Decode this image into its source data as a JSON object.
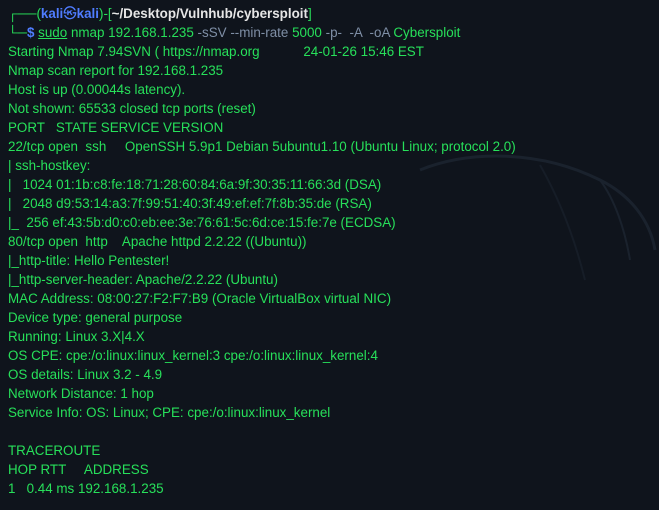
{
  "prompt": {
    "user": "kali",
    "skull": "㉿",
    "host": "kali",
    "path": "~/Desktop/Vulnhub/cybersploit",
    "sudo": "sudo",
    "program": "nmap",
    "target_ip": "192.168.1.235",
    "opt1": "-sSV",
    "opt2": "--min-rate",
    "rate": "5000",
    "opt3": "-p-",
    "opt4": "-A",
    "opt5": "-oA",
    "outname": "Cybersploit"
  },
  "output": {
    "start_a": "Starting Nmap 7.94SVN ( https://nmap.org",
    "start_b": "24-01-26 15:46 EST",
    "lines": [
      "Nmap scan report for 192.168.1.235",
      "Host is up (0.00044s latency).",
      "Not shown: 65533 closed tcp ports (reset)",
      "PORT   STATE SERVICE VERSION",
      "22/tcp open  ssh     OpenSSH 5.9p1 Debian 5ubuntu1.10 (Ubuntu Linux; protocol 2.0)",
      "| ssh-hostkey: ",
      "|   1024 01:1b:c8:fe:18:71:28:60:84:6a:9f:30:35:11:66:3d (DSA)",
      "|   2048 d9:53:14:a3:7f:99:51:40:3f:49:ef:ef:7f:8b:35:de (RSA)",
      "|_  256 ef:43:5b:d0:c0:eb:ee:3e:76:61:5c:6d:ce:15:fe:7e (ECDSA)",
      "80/tcp open  http    Apache httpd 2.2.22 ((Ubuntu))",
      "|_http-title: Hello Pentester!",
      "|_http-server-header: Apache/2.2.22 (Ubuntu)",
      "MAC Address: 08:00:27:F2:F7:B9 (Oracle VirtualBox virtual NIC)",
      "Device type: general purpose",
      "Running: Linux 3.X|4.X",
      "OS CPE: cpe:/o:linux:linux_kernel:3 cpe:/o:linux:linux_kernel:4",
      "OS details: Linux 3.2 - 4.9",
      "Network Distance: 1 hop",
      "Service Info: OS: Linux; CPE: cpe:/o:linux:linux_kernel",
      "",
      "TRACEROUTE",
      "HOP RTT     ADDRESS",
      "1   0.44 ms 192.168.1.235"
    ]
  },
  "colors": {
    "background": "#0f141c",
    "output_green": "#27e05a",
    "prompt_blue": "#4f7cff",
    "path_white": "#e6e6e6"
  }
}
